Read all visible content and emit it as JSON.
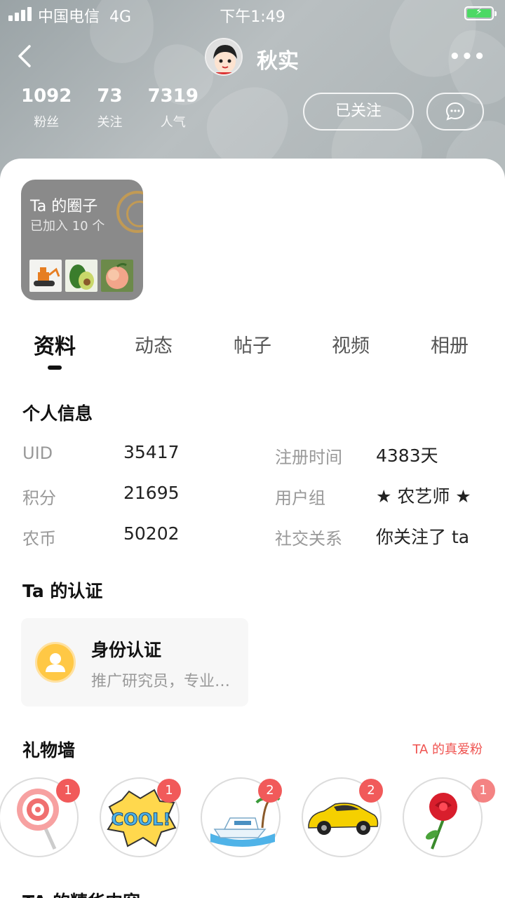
{
  "status_bar": {
    "carrier": "中国电信",
    "network": "4G",
    "time": "下午1:49"
  },
  "header": {
    "username": "秋实",
    "stats": [
      {
        "value": "1092",
        "label": "粉丝"
      },
      {
        "value": "73",
        "label": "关注"
      },
      {
        "value": "7319",
        "label": "人气"
      }
    ],
    "follow_label": "已关注",
    "more_label": "•••"
  },
  "circle_card": {
    "title": "Ta 的圈子",
    "subtitle": "已加入 10 个"
  },
  "tabs": [
    "资料",
    "动态",
    "帖子",
    "视频",
    "相册"
  ],
  "personal_info": {
    "title": "个人信息",
    "rows": [
      {
        "label": "UID",
        "value": "35417"
      },
      {
        "label": "注册时间",
        "value": "4383天"
      },
      {
        "label": "积分",
        "value": "21695"
      },
      {
        "label": "用户组",
        "value": "★ 农艺师 ★"
      },
      {
        "label": "农币",
        "value": "50202"
      },
      {
        "label": "社交关系",
        "value": "你关注了 ta"
      }
    ]
  },
  "certification": {
    "title": "Ta 的认证",
    "card_title": "身份认证",
    "card_subtitle": "推广研究员，专业从事农业技术推广"
  },
  "gift_wall": {
    "title": "礼物墙",
    "fans_link": "TA 的真爱粉",
    "gifts": [
      {
        "icon": "lollipop-icon",
        "count": "1"
      },
      {
        "icon": "cool-sticker-icon",
        "count": "1"
      },
      {
        "icon": "yacht-icon",
        "count": "2"
      },
      {
        "icon": "sports-car-icon",
        "count": "2"
      },
      {
        "icon": "rose-icon",
        "count": "1"
      }
    ]
  },
  "featured": {
    "title": "TA 的精华内容"
  },
  "colors": {
    "accent_red": "#ef5350",
    "badge_red": "#f15a5a",
    "cert_yellow": "#ffc845"
  }
}
